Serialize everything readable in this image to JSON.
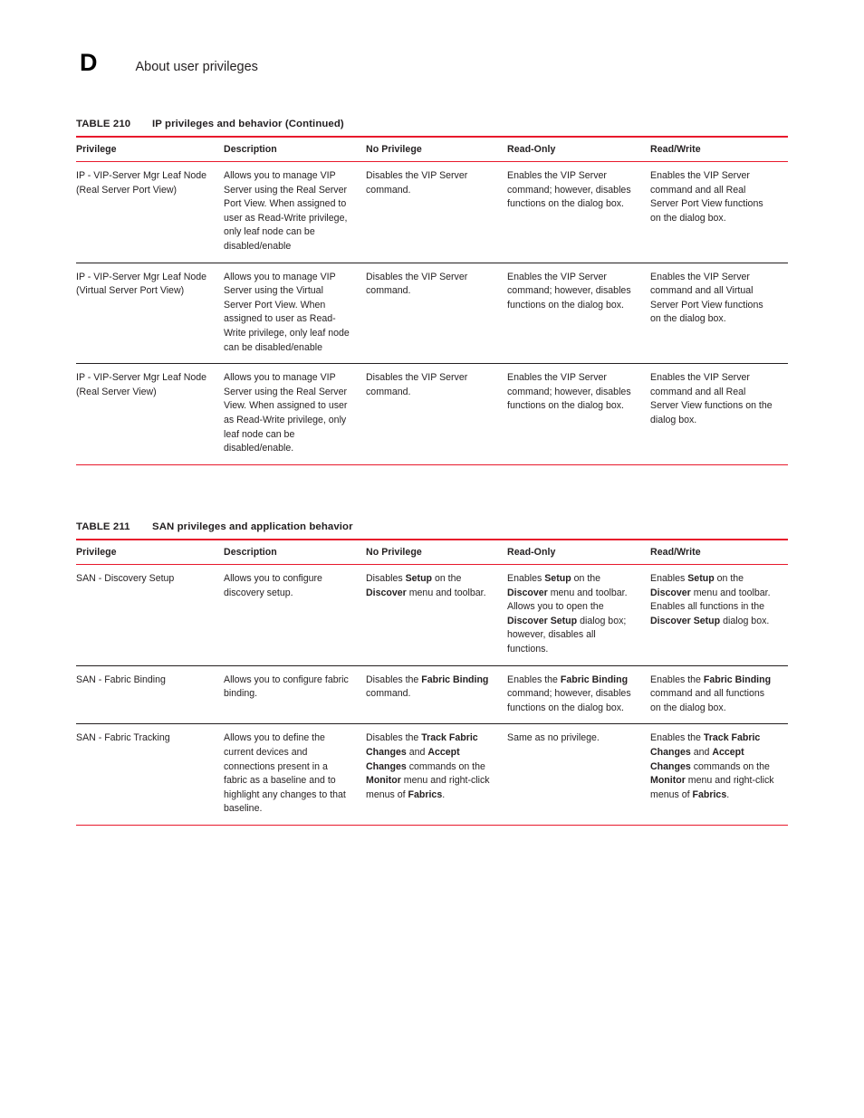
{
  "page": {
    "chapter_letter": "D",
    "chapter_title": "About user privileges"
  },
  "columns": [
    "Privilege",
    "Description",
    "No Privilege",
    "Read-Only",
    "Read/Write"
  ],
  "colors": {
    "rule_red": "#E8192C",
    "text": "#231F20"
  },
  "tables": [
    {
      "caption_number": "TABLE 210",
      "caption_text": "IP privileges and behavior (Continued)",
      "headers": [
        "Privilege",
        "Description",
        "No Privilege",
        "Read-Only",
        "Read/Write"
      ],
      "rows": [
        {
          "privilege": "IP - VIP-Server Mgr Leaf Node (Real Server Port View)",
          "description": "Allows you to manage VIP Server using the Real Server Port View. When assigned to user as Read-Write privilege, only leaf node can be disabled/enable",
          "no_privilege": "Disables the VIP Server command.",
          "read_only": "Enables the VIP Server command; however, disables functions on the dialog box.",
          "read_write": "Enables the VIP Server command and all Real Server Port View functions on the dialog box."
        },
        {
          "privilege": "IP - VIP-Server Mgr Leaf Node (Virtual Server Port View)",
          "description": "Allows you to manage VIP Server using the Virtual Server Port View. When assigned to user as Read-Write privilege, only leaf node can be disabled/enable",
          "no_privilege": "Disables the VIP Server command.",
          "read_only": "Enables the VIP Server command; however, disables functions on the dialog box.",
          "read_write": "Enables the VIP Server command and all Virtual Server Port View functions on the dialog box."
        },
        {
          "privilege": "IP - VIP-Server Mgr Leaf Node (Real Server View)",
          "description": "Allows you to manage VIP Server using the Real Server View. When assigned to user as Read-Write privilege, only leaf node can be disabled/enable.",
          "no_privilege": "Disables the VIP Server command.",
          "read_only": "Enables the VIP Server command; however, disables functions on the dialog box.",
          "read_write": "Enables the VIP Server command and all Real Server View functions on the dialog box."
        }
      ]
    },
    {
      "caption_number": "TABLE 211",
      "caption_text": "SAN privileges and application behavior",
      "headers": [
        "Privilege",
        "Description",
        "No Privilege",
        "Read-Only",
        "Read/Write"
      ],
      "rows": [
        {
          "privilege": "SAN - Discovery Setup",
          "description": "Allows you to configure discovery setup.",
          "no_privilege": "Disables <b>Setup</b> on the <b>Discover</b> menu and toolbar.",
          "read_only": "Enables <b>Setup</b> on the <b>Discover</b> menu and toolbar. Allows you to open the <b>Discover Setup</b> dialog box; however, disables all functions.",
          "read_write": "Enables <b>Setup</b> on the <b>Discover</b> menu and toolbar. Enables all functions in the <b>Discover Setup</b> dialog box."
        },
        {
          "privilege": "SAN - Fabric Binding",
          "description": "Allows you to configure fabric binding.",
          "no_privilege": "Disables the <b>Fabric Binding</b> command.",
          "read_only": "Enables the <b>Fabric Binding</b> command; however, disables functions on the dialog box.",
          "read_write": "Enables the <b>Fabric Binding</b> command and all functions on the dialog box."
        },
        {
          "privilege": "SAN - Fabric Tracking",
          "description": "Allows you to define the current devices and connections present in a fabric as a baseline and to highlight any changes to that baseline.",
          "no_privilege": "Disables the <b>Track Fabric Changes</b> and <b>Accept Changes</b> commands on the <b>Monitor</b> menu and right-click menus of <b>Fabrics</b>.",
          "read_only": "Same as no privilege.",
          "read_write": "Enables the <b>Track Fabric Changes</b> and <b>Accept Changes</b> commands on the <b>Monitor</b> menu and right-click menus of <b>Fabrics</b>."
        }
      ]
    }
  ]
}
